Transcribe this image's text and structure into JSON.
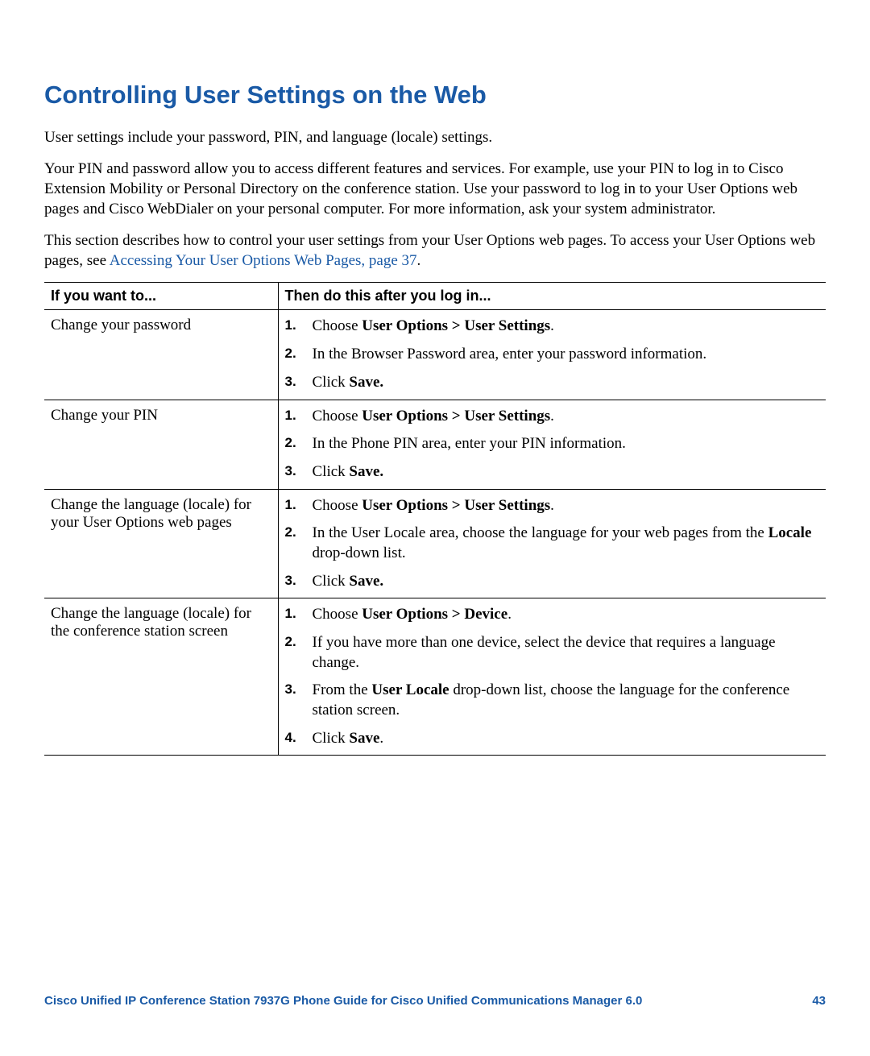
{
  "title": "Controlling User Settings on the Web",
  "para1": "User settings include your password, PIN, and language (locale) settings.",
  "para2": "Your PIN and password allow you to access different features and services. For example, use your PIN to log in to Cisco Extension Mobility or Personal Directory on the conference station. Use your password to log in to your User Options web pages and Cisco WebDialer on your personal computer. For more information, ask your system administrator.",
  "para3_pre": "This section describes how to control your user settings from your User Options web pages. To access your User Options web pages, see ",
  "para3_link": "Accessing Your User Options Web Pages, page 37",
  "para3_post": ".",
  "headers": {
    "col1": "If you want to...",
    "col2": "Then do this after you log in..."
  },
  "rows": [
    {
      "want": "Change your password",
      "steps": [
        {
          "pre": "Choose ",
          "bold": "User Options > User Settings",
          "post": "."
        },
        {
          "pre": "In the Browser Password area, enter your password information."
        },
        {
          "pre": "Click ",
          "bold": "Save."
        }
      ]
    },
    {
      "want": "Change your PIN",
      "steps": [
        {
          "pre": "Choose ",
          "bold": "User Options > User Settings",
          "post": "."
        },
        {
          "pre": "In the Phone PIN area, enter your PIN information."
        },
        {
          "pre": "Click ",
          "bold": "Save."
        }
      ]
    },
    {
      "want": "Change the language (locale) for your User Options web pages",
      "steps": [
        {
          "pre": "Choose ",
          "bold": "User Options > User Settings",
          "post": "."
        },
        {
          "pre": "In the User Locale area, choose the language for your web pages from the ",
          "bold": "Locale",
          "post": " drop-down list."
        },
        {
          "pre": "Click ",
          "bold": "Save."
        }
      ]
    },
    {
      "want": "Change the language (locale) for the conference station screen",
      "steps": [
        {
          "pre": "Choose ",
          "bold": "User Options > Device",
          "post": "."
        },
        {
          "pre": "If you have more than one device, select the device that requires a language change."
        },
        {
          "pre": "From the ",
          "bold": "User Locale",
          "post": " drop-down list, choose the language for the conference station screen."
        },
        {
          "pre": "Click ",
          "bold": "Save",
          "post": "."
        }
      ]
    }
  ],
  "footer_text": "Cisco Unified IP Conference Station 7937G Phone Guide for Cisco Unified Communications Manager 6.0",
  "footer_page": "43"
}
